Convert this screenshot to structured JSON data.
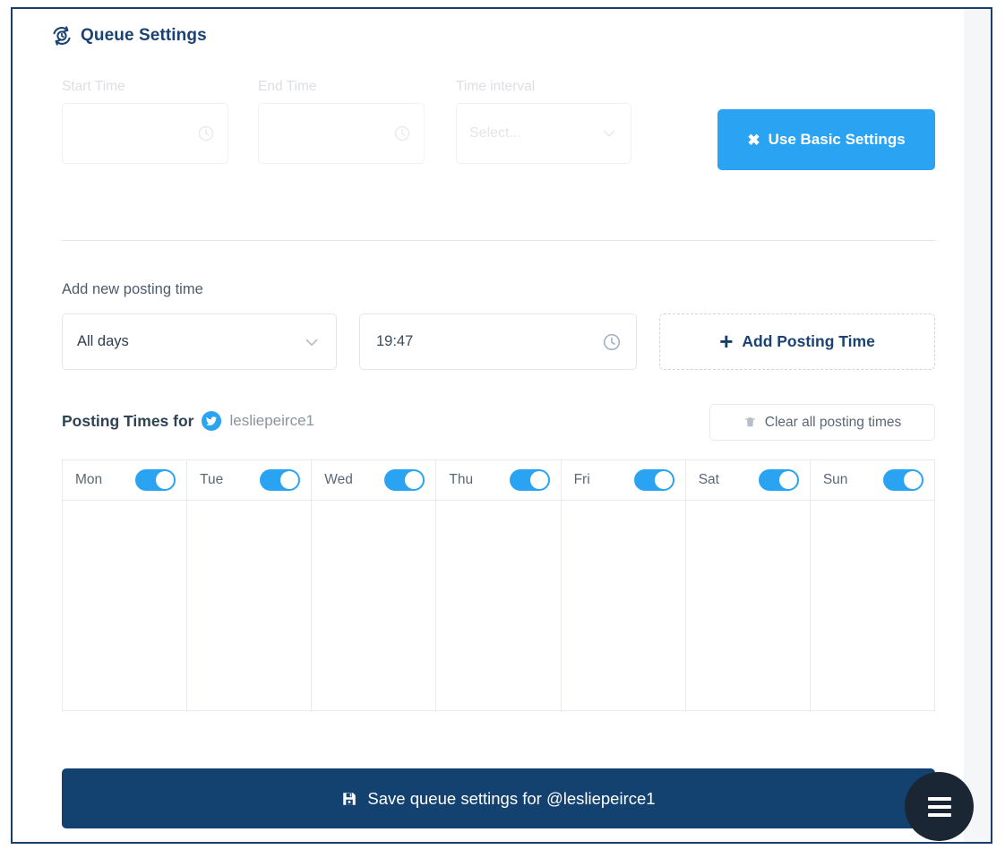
{
  "header": {
    "title": "Queue Settings",
    "icon": "queue-clock-icon"
  },
  "advanced_settings": {
    "start_time": {
      "label": "Start Time",
      "value": "",
      "placeholder": "",
      "icon": "clock-icon",
      "disabled": true
    },
    "end_time": {
      "label": "End Time",
      "value": "",
      "placeholder": "",
      "icon": "clock-icon",
      "disabled": true
    },
    "time_interval": {
      "label": "Time interval",
      "placeholder": "Select...",
      "value": "",
      "icon": "chevron-down-icon",
      "disabled": true
    },
    "basic_settings_button": {
      "label": "Use Basic Settings",
      "icon": "close-x-icon",
      "color": "#29a3f2"
    }
  },
  "add_posting": {
    "section_label": "Add new posting time",
    "days_select": {
      "value": "All days",
      "icon": "chevron-down-icon"
    },
    "time_input": {
      "value": "19:47",
      "icon": "clock-icon"
    },
    "add_button": {
      "label": "Add Posting Time",
      "icon": "plus-icon"
    }
  },
  "posting_times": {
    "heading": "Posting Times for",
    "account_handle": "lesliepeirce1",
    "account_icon": "twitter-icon",
    "clear_button": {
      "label": "Clear all posting times",
      "icon": "trash-icon"
    },
    "days": [
      {
        "name": "Mon",
        "enabled": true,
        "times": []
      },
      {
        "name": "Tue",
        "enabled": true,
        "times": []
      },
      {
        "name": "Wed",
        "enabled": true,
        "times": []
      },
      {
        "name": "Thu",
        "enabled": true,
        "times": []
      },
      {
        "name": "Fri",
        "enabled": true,
        "times": []
      },
      {
        "name": "Sat",
        "enabled": true,
        "times": []
      },
      {
        "name": "Sun",
        "enabled": true,
        "times": []
      }
    ]
  },
  "save_bar": {
    "label": "Save queue settings for @lesliepeirce1",
    "icon": "save-disk-icon",
    "color": "#134270"
  },
  "fab": {
    "icon": "hamburger-menu-icon",
    "color": "#1a2633"
  },
  "colors": {
    "accent_blue": "#29a3f2",
    "navy": "#134270",
    "border": "#e6e9ed",
    "muted_text": "#5a6775"
  }
}
